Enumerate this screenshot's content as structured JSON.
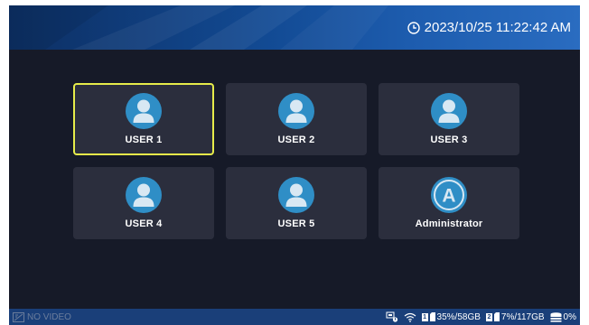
{
  "header": {
    "datetime": "2023/10/25 11:22:42 AM",
    "clock_icon": "clock-icon"
  },
  "users": [
    {
      "label": "USER 1",
      "icon": "user-avatar-icon",
      "selected": true
    },
    {
      "label": "USER 2",
      "icon": "user-avatar-icon",
      "selected": false
    },
    {
      "label": "USER 3",
      "icon": "user-avatar-icon",
      "selected": false
    },
    {
      "label": "USER 4",
      "icon": "user-avatar-icon",
      "selected": false
    },
    {
      "label": "USER 5",
      "icon": "user-avatar-icon",
      "selected": false
    },
    {
      "label": "Administrator",
      "icon": "admin-avatar-icon",
      "letter": "A",
      "selected": false
    }
  ],
  "status": {
    "video_text": "NO VIDEO",
    "disk1_badge": "1",
    "disk1_text": "35%/58GB",
    "disk2_badge": "2",
    "disk2_text": "7%/117GB",
    "hdd_text": "0%"
  },
  "colors": {
    "background": "#161a28",
    "tile": "#2b2e3d",
    "avatar": "#2f8ec6",
    "selection": "#e6ec4a",
    "status_bar": "#1a3f79"
  }
}
